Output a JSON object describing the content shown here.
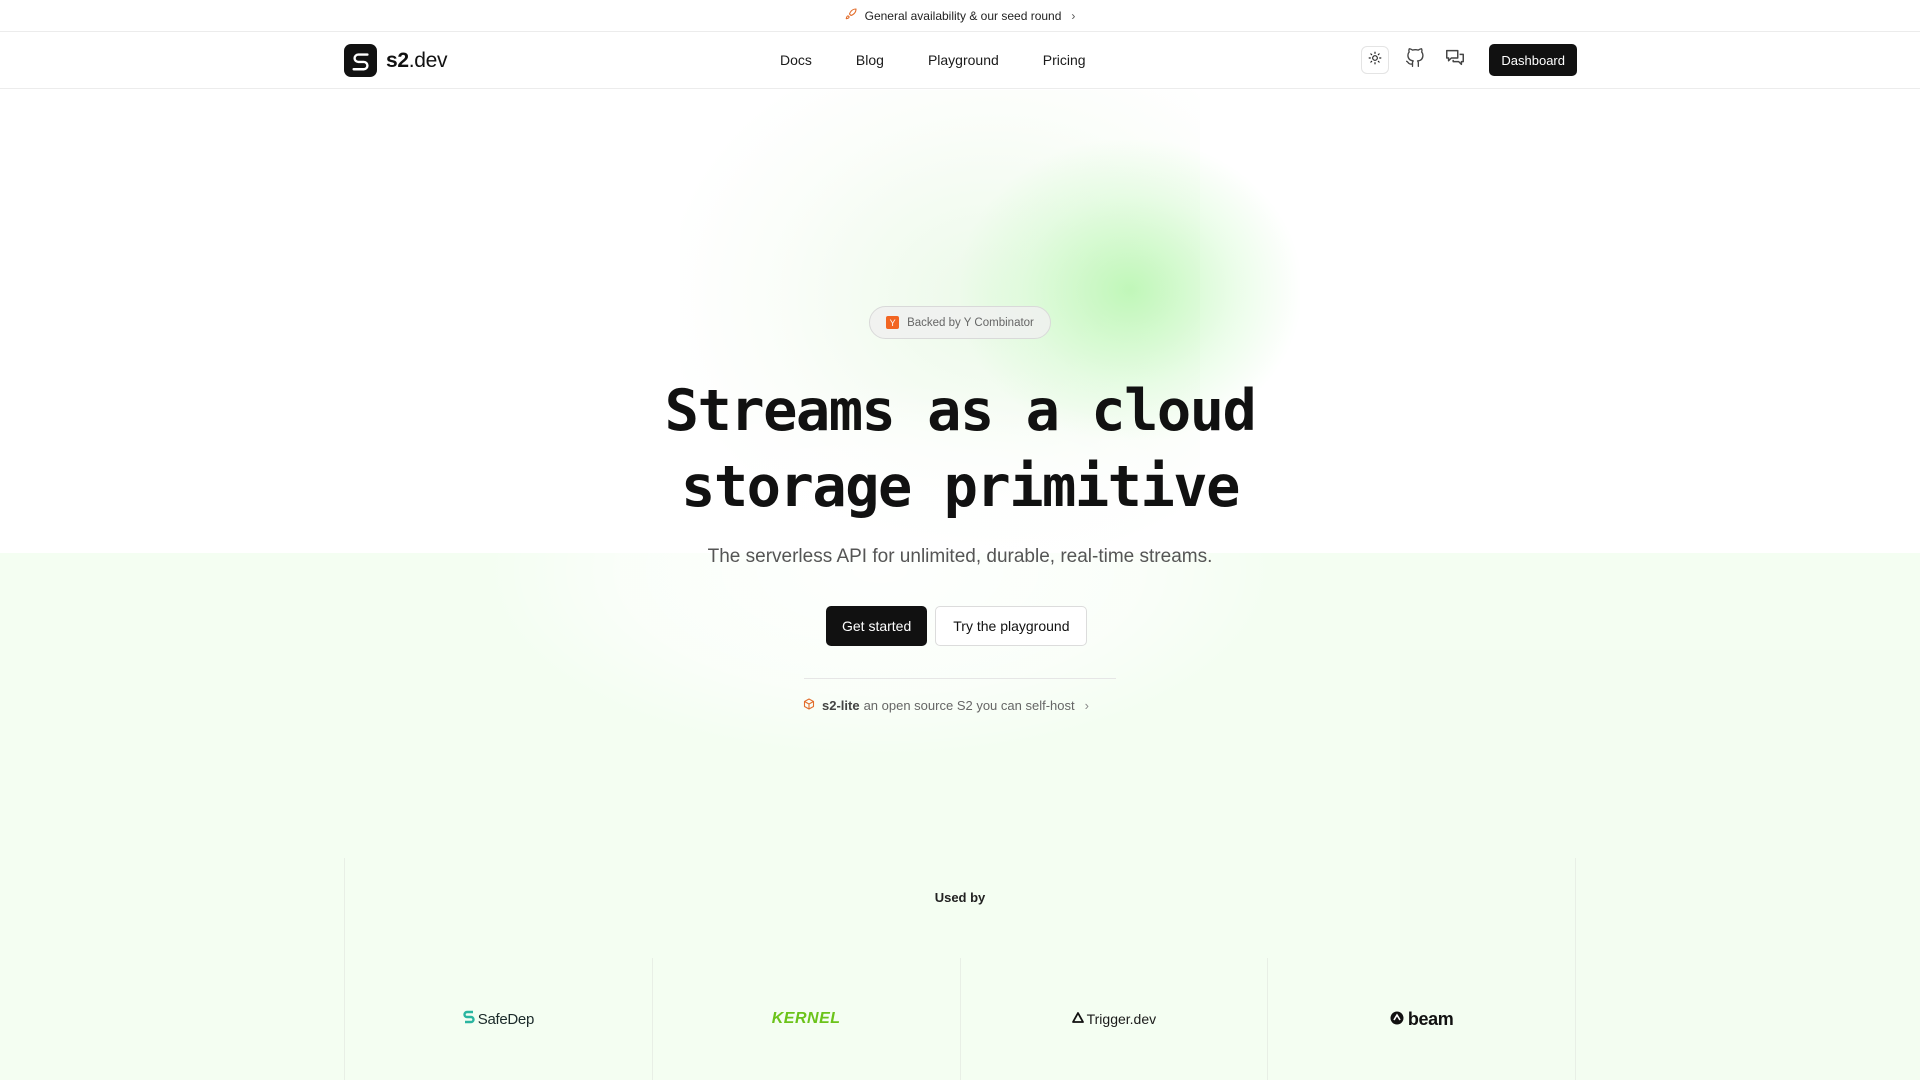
{
  "announcement": {
    "icon": "rocket-icon",
    "text": "General availability & our seed round",
    "chevron": "›"
  },
  "nav": {
    "logo_bold": "s2",
    "logo_rest": ".dev",
    "links": [
      "Docs",
      "Blog",
      "Playground",
      "Pricing"
    ],
    "dashboard_label": "Dashboard"
  },
  "hero": {
    "badge_mark": "Y",
    "badge_text": "Backed by Y Combinator",
    "headline_line1": "Streams as a cloud",
    "headline_line2": "storage primitive",
    "subheadline": "The serverless API for unlimited, durable, real-time streams.",
    "primary_cta": "Get started",
    "secondary_cta": "Try the playground",
    "lite_name": "s2-lite",
    "lite_text": "an open source S2 you can self-host",
    "lite_chevron": "›"
  },
  "used_by": {
    "title": "Used by",
    "logos": [
      "SafeDep",
      "KERNEL",
      "Trigger.dev",
      "beam"
    ]
  },
  "colors": {
    "accent_green": "#aaf5a0",
    "brand_dark": "#111111",
    "yc_orange": "#f26522"
  }
}
